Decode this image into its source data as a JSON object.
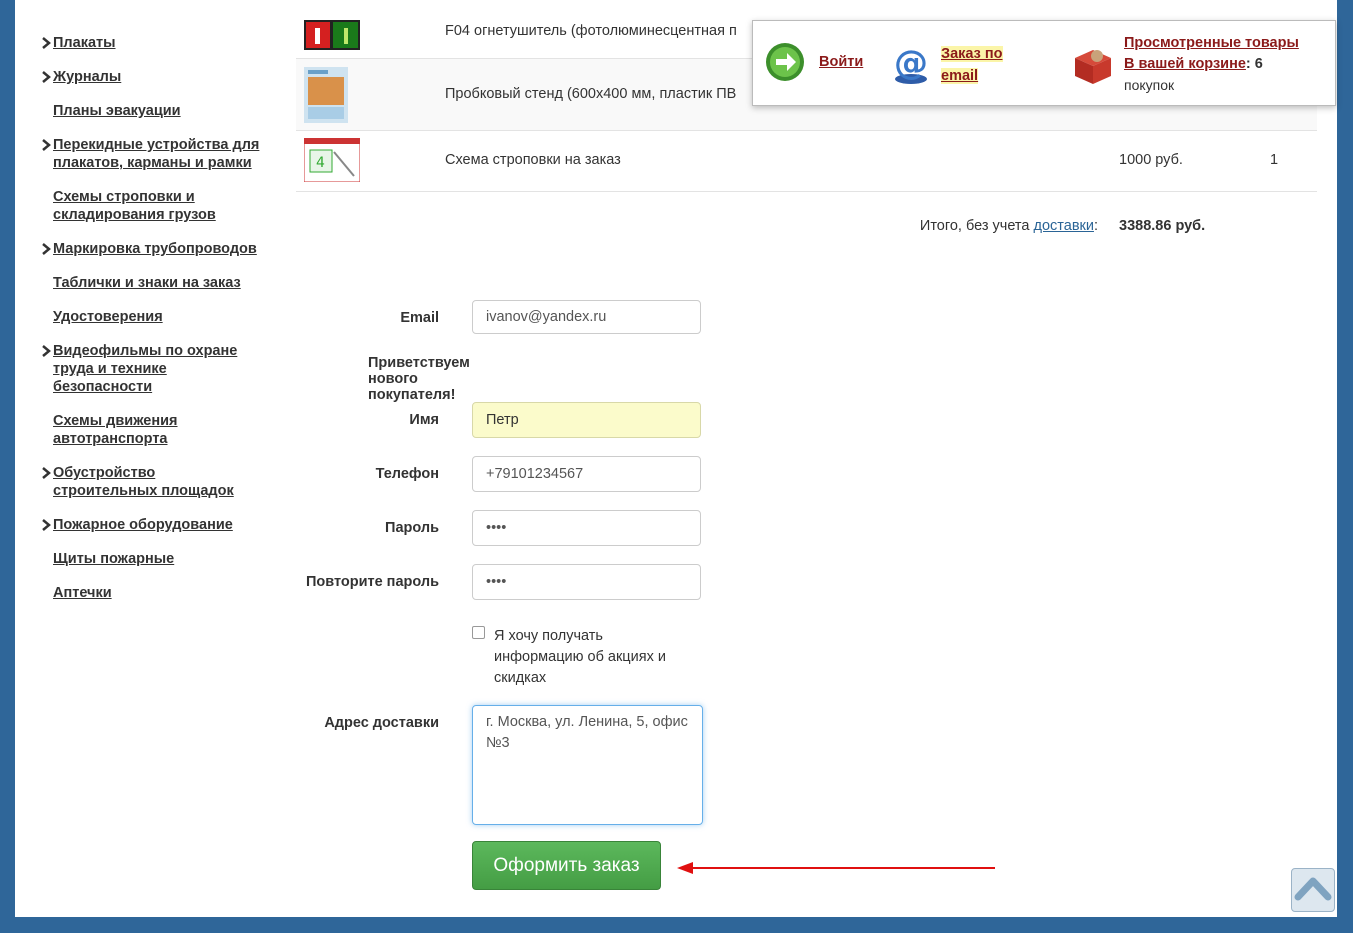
{
  "sidebar": {
    "items": [
      {
        "label": "Плакаты",
        "arrow": true
      },
      {
        "label": "Журналы",
        "arrow": true
      },
      {
        "label": "Планы эвакуации",
        "arrow": false
      },
      {
        "label": "Перекидные устройства для плакатов, карманы и рамки",
        "arrow": true
      },
      {
        "label": "Схемы строповки и складирования грузов",
        "arrow": false
      },
      {
        "label": "Маркировка трубопроводов",
        "arrow": true
      },
      {
        "label": "Таблички и знаки на заказ",
        "arrow": false
      },
      {
        "label": "Удостоверения",
        "arrow": false
      },
      {
        "label": "Видеофильмы по охране труда и технике безопасности",
        "arrow": true
      },
      {
        "label": "Схемы движения автотранспорта",
        "arrow": false
      },
      {
        "label": "Обустройство строительных площадок",
        "arrow": true
      },
      {
        "label": "Пожарное оборудование",
        "arrow": true
      },
      {
        "label": "Щиты пожарные",
        "arrow": false
      },
      {
        "label": "Аптечки",
        "arrow": false
      }
    ]
  },
  "cart": {
    "rows": [
      {
        "name": "F04 огнетушитель (фотолюминесцентная п",
        "price": "",
        "qty": ""
      },
      {
        "name": "Пробковый стенд (600х400 мм, пластик ПВ",
        "price": "",
        "qty": ""
      },
      {
        "name": "Схема строповки на заказ",
        "price": "1000 руб.",
        "qty": "1"
      }
    ],
    "total_prefix": "Итого, без учета ",
    "total_link": "доставки",
    "total_suffix": ":",
    "total_value": "3388.86 руб."
  },
  "form": {
    "email_label": "Email",
    "email_value": "ivanov@yandex.ru",
    "greeting": "Приветствуем нового покупателя!",
    "name_label": "Имя",
    "name_value": "Петр",
    "phone_label": "Телефон",
    "phone_value": "+79101234567",
    "password_label": "Пароль",
    "password_value": "••••",
    "password2_label": "Повторите пароль",
    "password2_value": "••••",
    "subscribe_label": "Я хочу получать информацию об акциях и скидках",
    "address_label": "Адрес доставки",
    "address_value": "г. Москва, ул. Ленина, 5, офис №3",
    "submit_label": "Оформить заказ"
  },
  "popup": {
    "login_label": "Войти",
    "email_order_label": "Заказ по email",
    "viewed_label": "Просмотренные товары",
    "basket_label": "В вашей корзине",
    "basket_count": "6",
    "basket_suffix": "покупок"
  },
  "colors": {
    "background": "#2f6699",
    "link_red": "#8b1a1a",
    "submit_green": "#4cae4c",
    "highlight_yellow": "#fbfbcb"
  }
}
